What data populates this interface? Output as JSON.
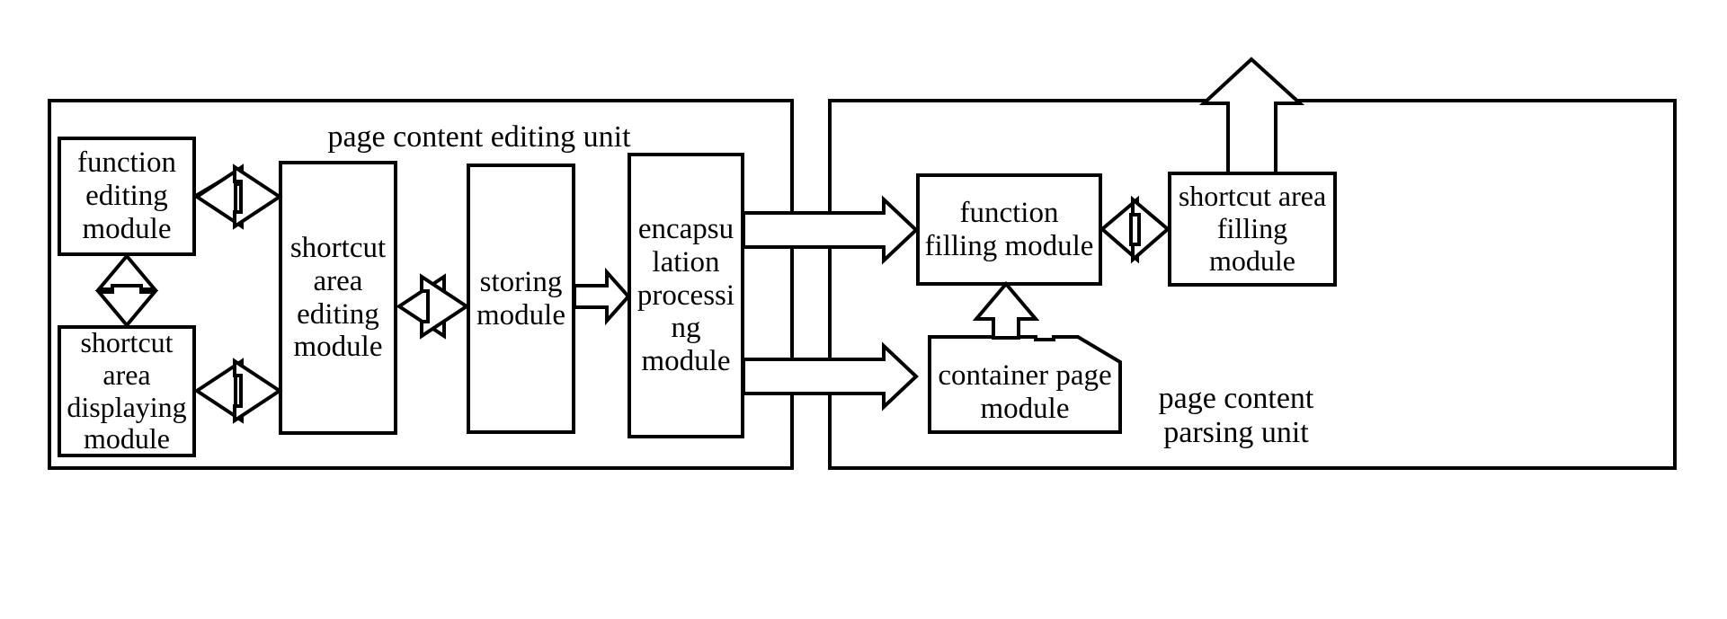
{
  "diagram": {
    "type": "block-diagram",
    "title_style": "patent figure",
    "stroke_color": "#000000",
    "background": "#ffffff",
    "units": [
      {
        "id": "editing-unit",
        "label": "page content editing unit"
      },
      {
        "id": "parsing-unit",
        "label": "page content parsing unit"
      }
    ],
    "boxes": [
      {
        "id": "function-editing-module",
        "label": "function\nediting\nmodule"
      },
      {
        "id": "shortcut-area-displaying-module",
        "label": "shortcut\narea\ndisplaying\nmodule"
      },
      {
        "id": "shortcut-area-editing-module",
        "label": "shortcut\narea\nediting\nmodule"
      },
      {
        "id": "storing-module",
        "label": "storing\nmodule"
      },
      {
        "id": "encapsulation-processing-module",
        "label": "encapsu\nlation\nprocessi\nng\nmodule"
      },
      {
        "id": "function-filling-module",
        "label": "function\nfilling module"
      },
      {
        "id": "shortcut-area-filling-module",
        "label": "shortcut area\nfilling\nmodule"
      },
      {
        "id": "container-page-module",
        "label": "container page\nmodule"
      }
    ],
    "labels": {
      "function_editing": "function\nediting\nmodule",
      "function_editing_l1": "function",
      "function_editing_l2": "editing",
      "function_editing_l3": "module",
      "shortcut_displaying_l1": "shortcut",
      "shortcut_displaying_l2": "area",
      "shortcut_displaying_l3": "displaying",
      "shortcut_displaying_l4": "module",
      "shortcut_editing_l1": "shortcut",
      "shortcut_editing_l2": "area",
      "shortcut_editing_l3": "editing",
      "shortcut_editing_l4": "module",
      "storing_l1": "storing",
      "storing_l2": "module",
      "encapsulation_l1": "encapsu",
      "encapsulation_l2": "lation",
      "encapsulation_l3": "processi",
      "encapsulation_l4": "ng",
      "encapsulation_l5": "module",
      "function_filling_l1": "function",
      "function_filling_l2": "filling module",
      "shortcut_filling_l1": "shortcut area",
      "shortcut_filling_l2": "filling",
      "shortcut_filling_l3": "module",
      "container_page_l1": "container page",
      "container_page_l2": "module",
      "editing_unit_title": "page content editing unit",
      "parsing_unit_l1": "page content",
      "parsing_unit_l2": "parsing unit"
    },
    "connections": [
      {
        "from": "function-editing-module",
        "to": "shortcut-area-editing-module",
        "style": "double-headed-horizontal"
      },
      {
        "from": "function-editing-module",
        "to": "shortcut-area-displaying-module",
        "style": "double-headed-vertical"
      },
      {
        "from": "shortcut-area-displaying-module",
        "to": "shortcut-area-editing-module",
        "style": "double-headed-horizontal"
      },
      {
        "from": "shortcut-area-editing-module",
        "to": "storing-module",
        "style": "double-headed-horizontal"
      },
      {
        "from": "storing-module",
        "to": "encapsulation-processing-module",
        "style": "single-arrow-right"
      },
      {
        "from": "encapsulation-processing-module",
        "to": "function-filling-module",
        "style": "single-arrow-right"
      },
      {
        "from": "encapsulation-processing-module",
        "to": "container-page-module",
        "style": "single-arrow-right"
      },
      {
        "from": "container-page-module",
        "to": "function-filling-module",
        "style": "single-arrow-up"
      },
      {
        "from": "function-filling-module",
        "to": "shortcut-area-filling-module",
        "style": "double-headed-horizontal"
      },
      {
        "from": "shortcut-area-filling-module",
        "to": "external-output",
        "style": "single-arrow-up"
      }
    ]
  }
}
